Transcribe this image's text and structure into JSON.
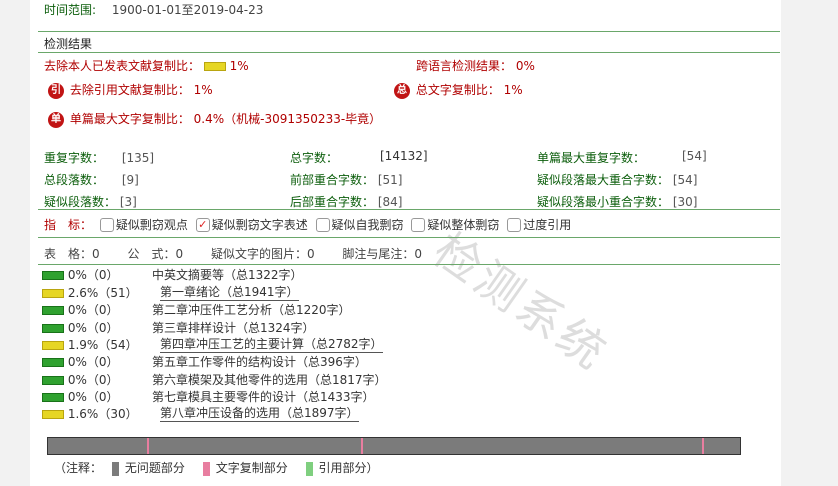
{
  "header": {
    "range_label": "时间范围:",
    "range_value": "1900-01-01至2019-04-23"
  },
  "watermark": "检测系统",
  "section_title": "检测结果",
  "summary": {
    "self_excluded_label": "去除本人已发表文献复制比：",
    "self_excluded_value": "1%",
    "cross_lang_label": "跨语言检测结果：",
    "cross_lang_value": "0%",
    "ref_excluded_icon": "引",
    "ref_excluded_label": "去除引用文献复制比：",
    "ref_excluded_value": "1%",
    "total_icon": "总",
    "total_label": "总文字复制比：",
    "total_value": "1%",
    "single_icon": "单",
    "single_label": "单篇最大文字复制比：",
    "single_value": "0.4%（机械-3091350233-毕竟）"
  },
  "stats": [
    [
      {
        "label": "重复字数：",
        "value": "[135]"
      },
      {
        "label": "总字数：",
        "value": "[14132]"
      },
      {
        "label": "单篇最大重复字数：",
        "value": "[54]"
      }
    ],
    [
      {
        "label": "总段落数：",
        "value": "[9]"
      },
      {
        "label": "前部重合字数：",
        "value": "[51]"
      },
      {
        "label": "疑似段落最大重合字数：",
        "value": "[54]"
      }
    ],
    [
      {
        "label": "疑似段落数：",
        "value": "[3]"
      },
      {
        "label": "后部重合字数：",
        "value": "[84]"
      },
      {
        "label": "疑似段落最小重合字数：",
        "value": "[30]"
      }
    ]
  ],
  "indicators": {
    "label": "指　标：",
    "items": [
      {
        "label": "疑似剽窃观点",
        "checked": false
      },
      {
        "label": "疑似剽窃文字表述",
        "checked": true
      },
      {
        "label": "疑似自我剽窃",
        "checked": false
      },
      {
        "label": "疑似整体剽窃",
        "checked": false
      },
      {
        "label": "过度引用",
        "checked": false
      }
    ]
  },
  "counts": {
    "tables": "表　格：0",
    "formulas": "公　式：0",
    "images": "疑似文字的图片：0",
    "footnotes": "脚注与尾注：0"
  },
  "chapters": [
    {
      "pct": "0%（0）",
      "name": "中英文摘要等（总1322字）",
      "color": "green",
      "linked": false
    },
    {
      "pct": "2.6%（51）",
      "name": "第一章绪论（总1941字）",
      "color": "yellow",
      "linked": true
    },
    {
      "pct": "0%（0）",
      "name": "第二章冲压件工艺分析（总1220字）",
      "color": "green",
      "linked": false
    },
    {
      "pct": "0%（0）",
      "name": "第三章排样设计（总1324字）",
      "color": "green",
      "linked": false
    },
    {
      "pct": "1.9%（54）",
      "name": "第四章冲压工艺的主要计算（总2782字）",
      "color": "yellow",
      "linked": true
    },
    {
      "pct": "0%（0）",
      "name": "第五章工作零件的结构设计（总396字）",
      "color": "green",
      "linked": false
    },
    {
      "pct": "0%（0）",
      "name": "第六章模架及其他零件的选用（总1817字）",
      "color": "green",
      "linked": false
    },
    {
      "pct": "0%（0）",
      "name": "第七章模具主要零件的设计（总1433字）",
      "color": "green",
      "linked": false
    },
    {
      "pct": "1.6%（30）",
      "name": "第八章冲压设备的选用（总1897字）",
      "color": "yellow",
      "linked": true
    }
  ],
  "track_marks": [
    0.143,
    0.453,
    0.945
  ],
  "legend": {
    "open": "（注释：",
    "no_issue": "无问题部分",
    "copied": "文字复制部分",
    "cited": "引用部分）"
  },
  "colors": {
    "no_issue": "#7b7b7b",
    "copied": "#e87ea0",
    "cited": "#7fcf7f"
  }
}
